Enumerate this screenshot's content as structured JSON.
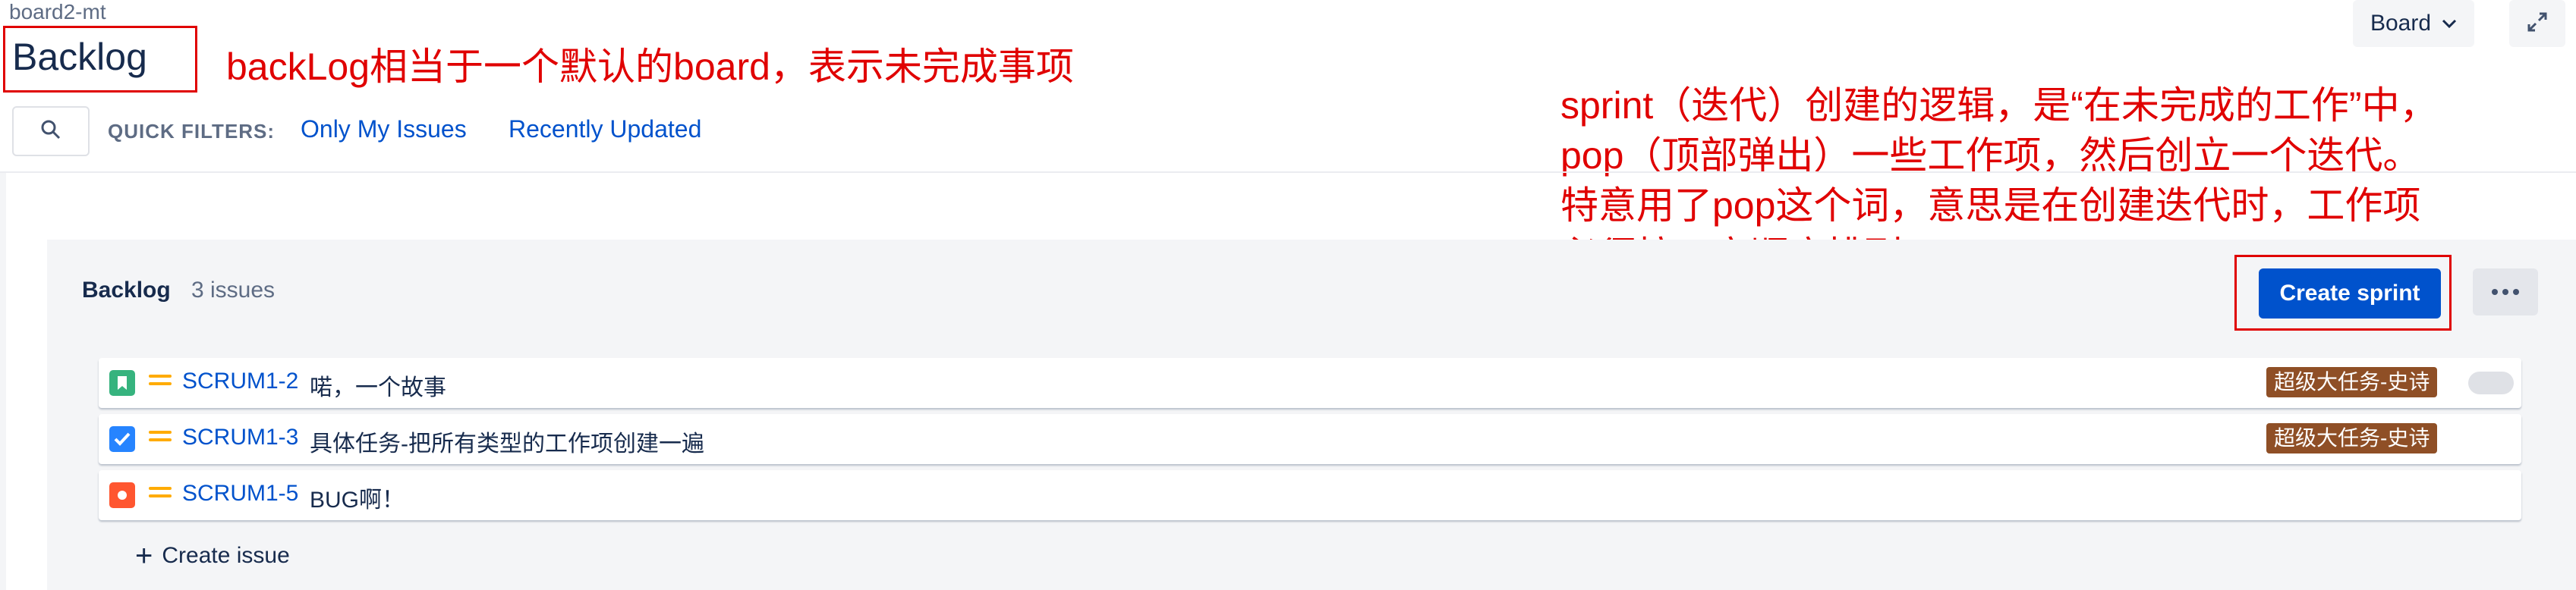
{
  "header": {
    "breadcrumb": "board2-mt",
    "title": "Backlog",
    "board_button": "Board",
    "annotation": "backLog相当于一个默认的board，表示未完成事项"
  },
  "filters": {
    "label": "QUICK FILTERS:",
    "items": [
      {
        "label": "Only My Issues"
      },
      {
        "label": "Recently Updated"
      }
    ]
  },
  "sprint_annotation": {
    "lines": [
      "sprint（迭代）创建的逻辑，是“在未完成的工作”中，",
      "pop（顶部弹出）一些工作项，然后创立一个迭代。",
      "特意用了pop这个词，意思是在创建迭代时，工作项",
      "必须按一定顺序排列。"
    ]
  },
  "backlog": {
    "title": "Backlog",
    "count": "3 issues",
    "create_sprint": "Create sprint",
    "create_issue": "Create issue",
    "issues": [
      {
        "type": "story",
        "key": "SCRUM1-2",
        "summary": "喏，一个故事",
        "epic": "超级大任务-史诗"
      },
      {
        "type": "task",
        "key": "SCRUM1-3",
        "summary": "具体任务-把所有类型的工作项创建一遍",
        "epic": "超级大任务-史诗"
      },
      {
        "type": "bug",
        "key": "SCRUM1-5",
        "summary": "BUG啊！",
        "epic": ""
      }
    ]
  },
  "colors": {
    "primary": "#0052cc",
    "annotation_red": "#e00000",
    "epic_brown": "#8f4f26",
    "story_green": "#36b37e",
    "task_blue": "#2684ff",
    "bug_red": "#ff5630",
    "priority_medium": "#ffab00"
  },
  "icons": {
    "search": "search-icon",
    "expand": "expand-icon",
    "more": "more-icon",
    "add": "plus-icon"
  }
}
